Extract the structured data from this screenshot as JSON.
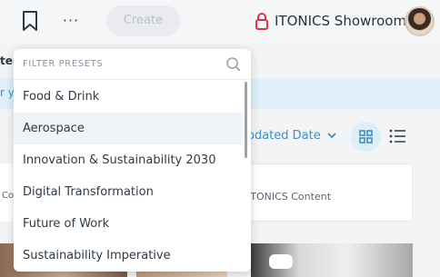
{
  "topbar": {
    "bookmark_icon": "bookmark-icon",
    "more_label": "···",
    "create_label": "Create",
    "workspace": "ITONICS Showroom",
    "lock_color": "#e0313c"
  },
  "background": {
    "section_fragment": "ter",
    "info_fragment": "r y",
    "sort_label": "odated Date",
    "card_source": "ITONICS Content",
    "card_fragment": "Co"
  },
  "filter_presets": {
    "title": "FILTER PRESETS",
    "items": [
      {
        "label": "Food & Drink",
        "active": false
      },
      {
        "label": "Aerospace",
        "active": true
      },
      {
        "label": "Innovation & Sustainability 2030",
        "active": false
      },
      {
        "label": "Digital Transformation",
        "active": false
      },
      {
        "label": "Future of Work",
        "active": false
      },
      {
        "label": "Sustainability Imperative",
        "active": false
      }
    ]
  },
  "colors": {
    "accent": "#3b8fc2",
    "active_row": "#eef4f8",
    "info_band": "#dff0f8"
  }
}
